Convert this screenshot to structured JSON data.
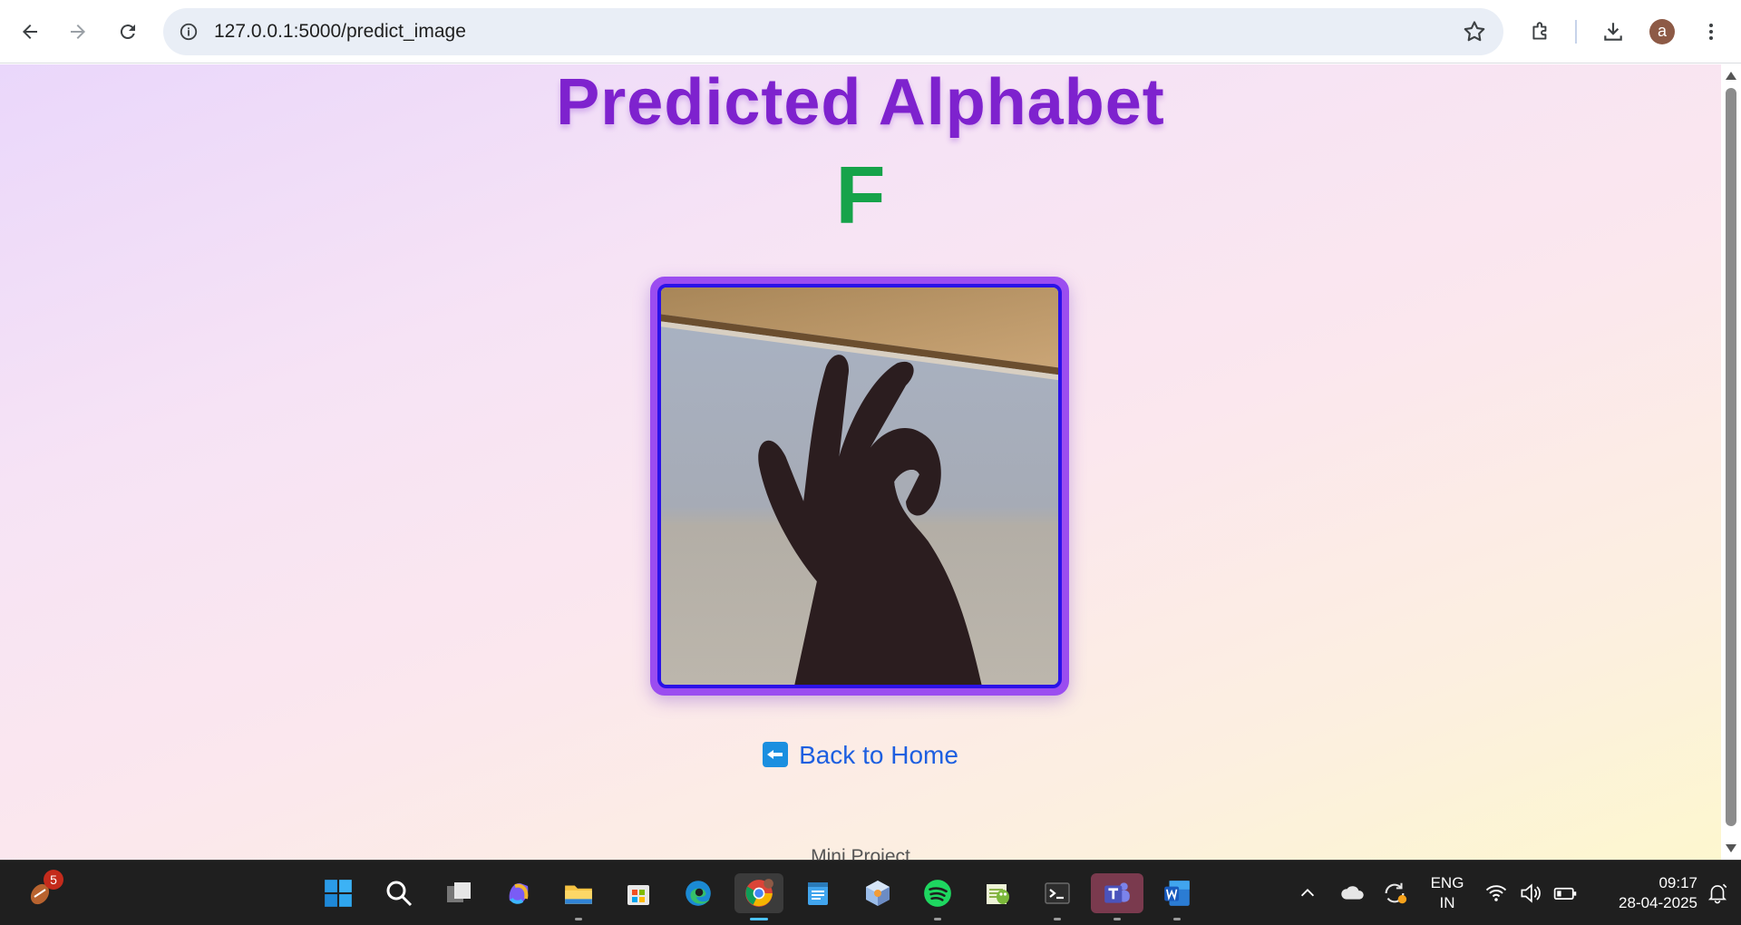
{
  "browser": {
    "url": "127.0.0.1:5000/predict_image",
    "profile_initial": "a"
  },
  "page": {
    "heading": "Predicted Alphabet",
    "predicted_letter": "F",
    "back_link": "Back to Home",
    "footer": "Mini Project",
    "colors": {
      "heading": "#7e22ce",
      "letter": "#16a34a",
      "link": "#1d5fe0",
      "frame": "#9b4df0"
    }
  },
  "taskbar": {
    "widget_badge": "5",
    "language": "ENG",
    "region": "IN",
    "time": "09:17",
    "date": "28-04-2025",
    "apps": [
      "start-icon",
      "search-icon",
      "task-view-icon",
      "copilot-icon",
      "file-explorer-icon",
      "store-icon",
      "edge-icon",
      "chrome-icon",
      "notepad-icon",
      "virtualbox-icon",
      "spotify-icon",
      "notepad-plus-icon",
      "terminal-icon",
      "teams-icon",
      "word-icon"
    ]
  }
}
